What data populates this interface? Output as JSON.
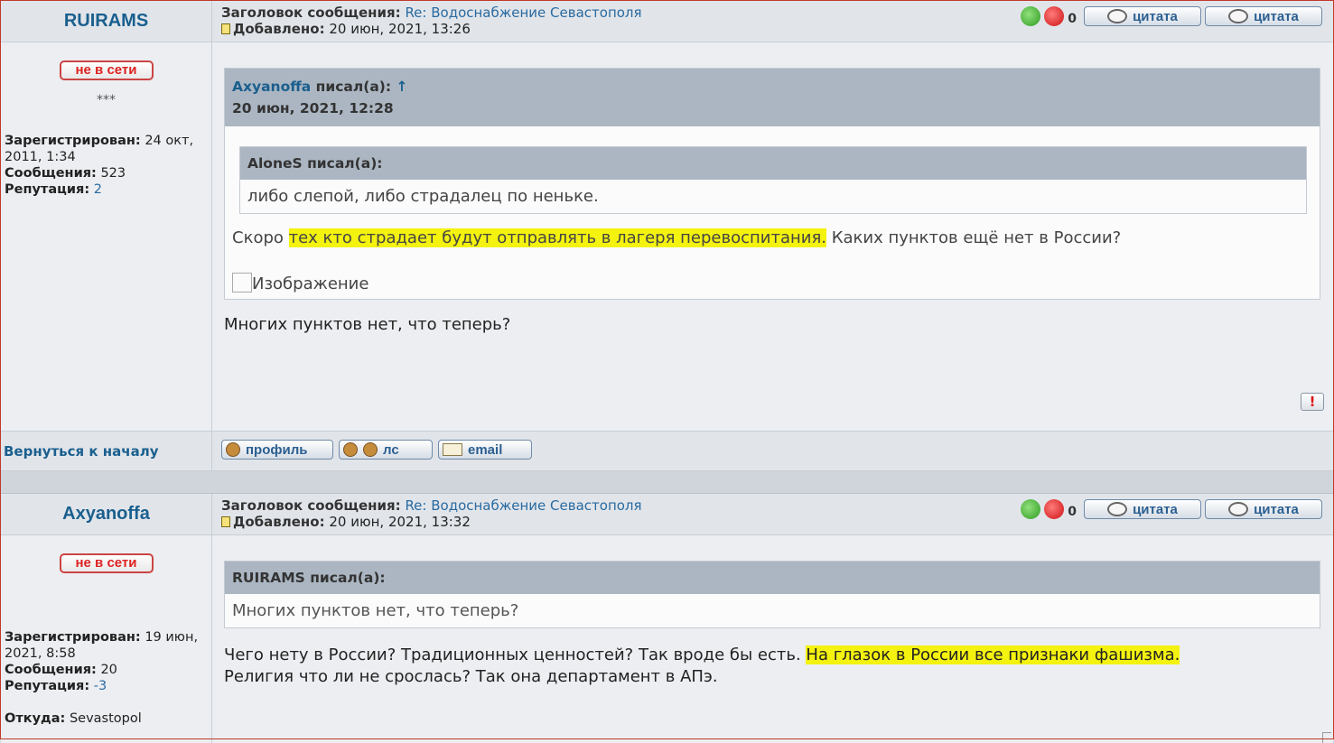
{
  "post1": {
    "author": "RUIRAMS",
    "status": "не в сети",
    "rank": "***",
    "registered_label": "Зарегистрирован:",
    "registered_value": "24 окт, 2011, 1:34",
    "messages_label": "Сообщения:",
    "messages_value": "523",
    "rep_label": "Репутация:",
    "rep_value": "2",
    "subject_label": "Заголовок сообщения:",
    "subject": "Re: Водоснабжение Севастополя",
    "added_label": "Добавлено:",
    "added": "20 июн, 2021, 13:26",
    "votes": "0",
    "quote_btn": "цитата",
    "quote2_btn": "цитата",
    "quote": {
      "author": "Axyanoffa",
      "wrote": "писал(а):",
      "arrow": "↑",
      "date": "20 июн, 2021, 12:28",
      "inner_author": "AloneS",
      "inner_wrote": "писал(а):",
      "inner_text": "либо слепой, либо страдалец по неньке.",
      "text_before": "Скоро ",
      "text_hl": "тех кто страдает будут отправлять в лагеря перевоспитания.",
      "text_after": " Каких пунктов ещё нет в России?",
      "image_alt": "Изображение"
    },
    "message": "Многих пунктов нет, что теперь?",
    "back_to_top": "Вернуться к началу",
    "profile_btn": "профиль",
    "pm_btn": "лс",
    "email_btn": "email"
  },
  "post2": {
    "author": "Axyanoffa",
    "status": "не в сети",
    "registered_label": "Зарегистрирован:",
    "registered_value": "19 июн, 2021, 8:58",
    "messages_label": "Сообщения:",
    "messages_value": "20",
    "rep_label": "Репутация:",
    "rep_value": "-3",
    "from_label": "Откуда:",
    "from_value": "Sevastopol",
    "subject_label": "Заголовок сообщения:",
    "subject": "Re: Водоснабжение Севастополя",
    "added_label": "Добавлено:",
    "added": "20 июн, 2021, 13:32",
    "votes": "0",
    "quote_btn": "цитата",
    "quote2_btn": "цитата",
    "quote": {
      "author": "RUIRAMS",
      "wrote": "писал(а):",
      "text": "Многих пунктов нет, что теперь?"
    },
    "message_before": "Чего нету в России? Традиционных ценностей? Так вроде бы есть. ",
    "message_hl": "На глазок в России все признаки фашизма.",
    "message_line2": "Религия что ли не срослась? Так она департамент в АПэ."
  }
}
